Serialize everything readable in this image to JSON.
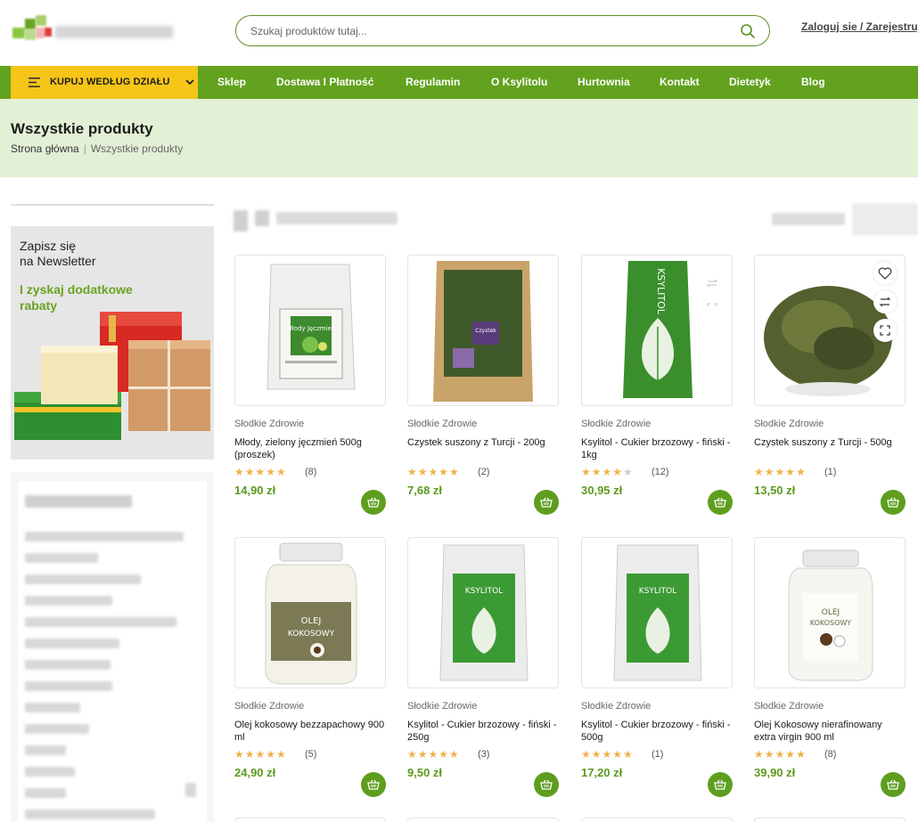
{
  "header": {
    "search_placeholder": "Szukaj produktów tutaj...",
    "login_label": "Zaloguj sie / Zarejestruj"
  },
  "nav": {
    "dept_label": "KUPUJ WEDŁUG DZIAŁU",
    "items": [
      "Sklep",
      "Dostawa I Płatność",
      "Regulamin",
      "O Ksylitolu",
      "Hurtownia",
      "Kontakt",
      "Dietetyk",
      "Blog"
    ]
  },
  "page": {
    "title": "Wszystkie produkty",
    "breadcrumb": [
      "Strona główna",
      "Wszystkie produkty"
    ]
  },
  "newsletter": {
    "line1": "Zapisz się",
    "line2": "na Newsletter",
    "promo": "I zyskaj dodatkowe rabaty"
  },
  "products": [
    {
      "brand": "Słodkie Zdrowie",
      "name": "Młody, zielony jęczmień 500g (proszek)",
      "rating": 5,
      "count": "(8)",
      "price": "14,90 zł"
    },
    {
      "brand": "Słodkie Zdrowie",
      "name": "Czystek suszony z Turcji - 200g",
      "rating": 5,
      "count": "(2)",
      "price": "7,68 zł"
    },
    {
      "brand": "Słodkie Zdrowie",
      "name": "Ksylitol - Cukier brzozowy - fiński - 1kg",
      "rating": 4.5,
      "count": "(12)",
      "price": "30,95 zł"
    },
    {
      "brand": "Słodkie Zdrowie",
      "name": "Czystek suszony z Turcji - 500g",
      "rating": 5,
      "count": "(1)",
      "price": "13,50 zł"
    },
    {
      "brand": "Słodkie Zdrowie",
      "name": "Olej kokosowy bezzapachowy 900 ml",
      "rating": 5,
      "count": "(5)",
      "price": "24,90 zł"
    },
    {
      "brand": "Słodkie Zdrowie",
      "name": "Ksylitol - Cukier brzozowy - fiński - 250g",
      "rating": 5,
      "count": "(3)",
      "price": "9,50 zł"
    },
    {
      "brand": "Słodkie Zdrowie",
      "name": "Ksylitol - Cukier brzozowy - fiński - 500g",
      "rating": 5,
      "count": "(1)",
      "price": "17,20 zł"
    },
    {
      "brand": "Słodkie Zdrowie",
      "name": "Olej Kokosowy nierafinowany extra virgin 900 ml",
      "rating": 5,
      "count": "(8)",
      "price": "39,90 zł"
    }
  ],
  "colors": {
    "brand_green": "#62a21e",
    "price_green": "#5b9a1d",
    "accent_yellow": "#f5c518",
    "band_bg": "#e2f0d5",
    "star": "#f0b24a"
  },
  "icons": {
    "search": "search-icon",
    "menu": "menu-icon",
    "chevron": "chevron-down-icon",
    "cart": "basket-icon",
    "wishlist": "heart-icon",
    "compare": "compare-icon",
    "quickview": "expand-icon"
  }
}
